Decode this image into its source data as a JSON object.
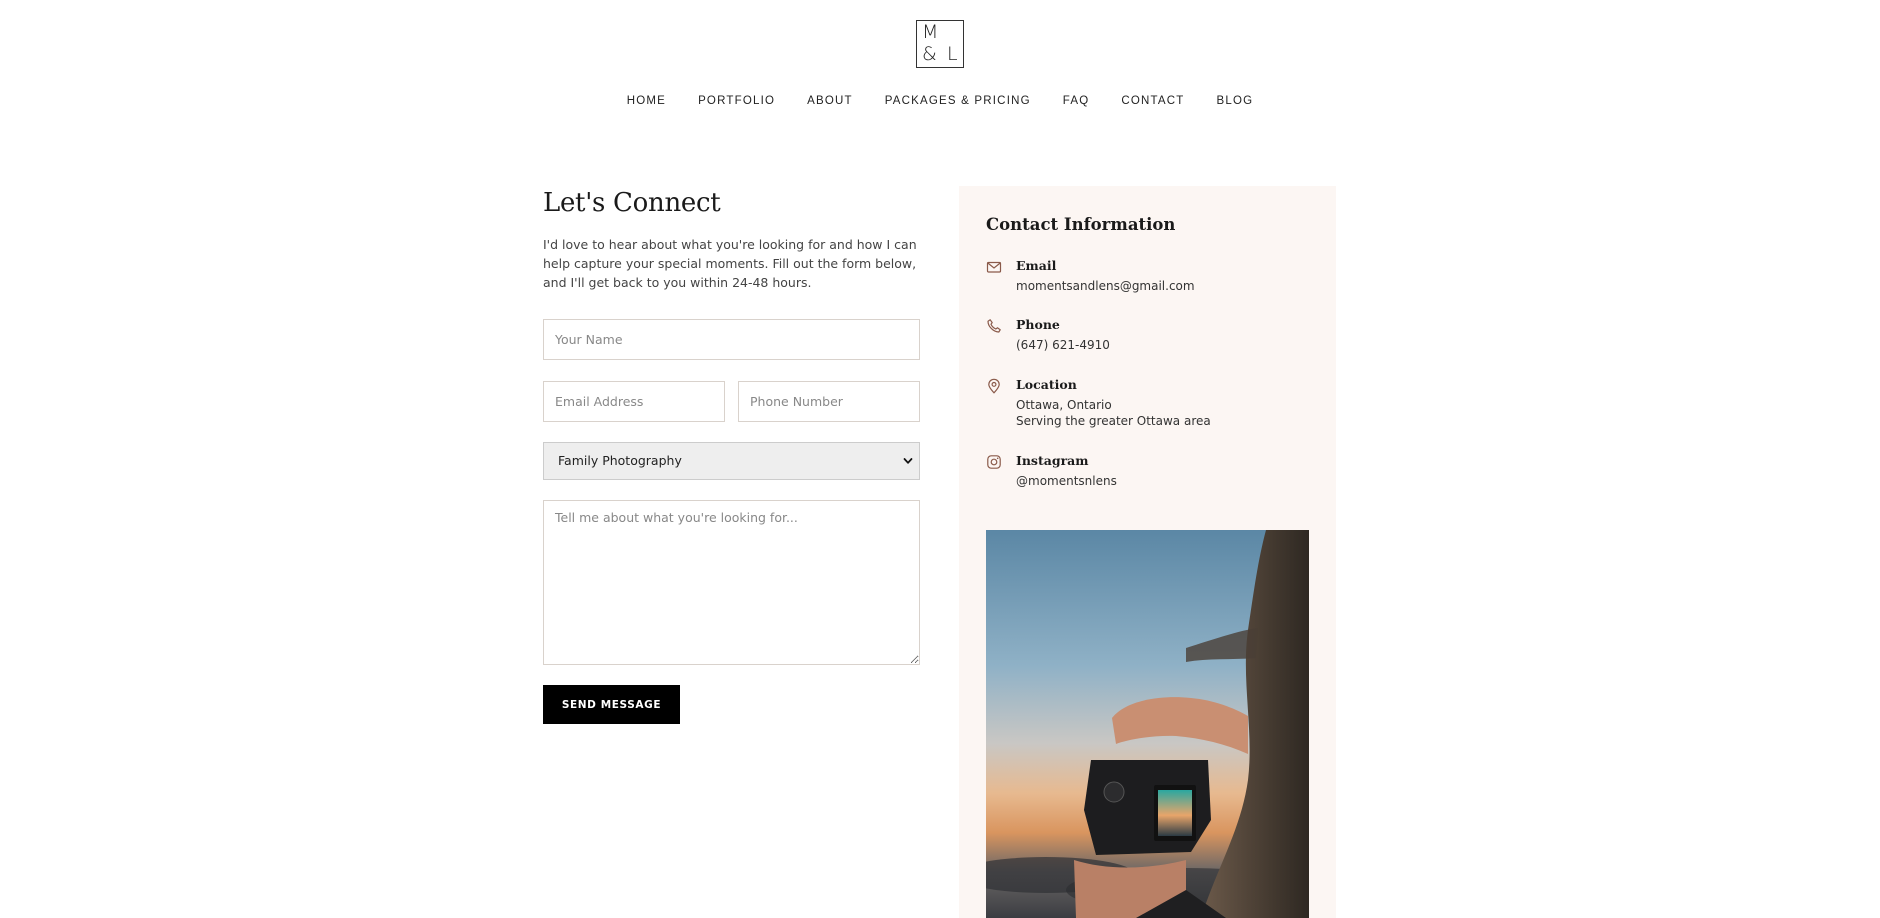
{
  "logo": {
    "line1": "M",
    "amp": "&",
    "line2": "L"
  },
  "nav": {
    "items": [
      "HOME",
      "PORTFOLIO",
      "ABOUT",
      "PACKAGES & PRICING",
      "FAQ",
      "CONTACT",
      "BLOG"
    ]
  },
  "form": {
    "title": "Let's Connect",
    "intro": "I'd love to hear about what you're looking for and how I can help capture your special moments. Fill out the form below, and I'll get back to you within 24-48 hours.",
    "name_placeholder": "Your Name",
    "email_placeholder": "Email Address",
    "phone_placeholder": "Phone Number",
    "service_selected": "Family Photography",
    "message_placeholder": "Tell me about what you're looking for...",
    "submit_label": "SEND MESSAGE"
  },
  "contact": {
    "title": "Contact Information",
    "email": {
      "label": "Email",
      "value": "momentsandlens@gmail.com",
      "icon": "mail-icon"
    },
    "phone": {
      "label": "Phone",
      "value": "(647) 621-4910",
      "icon": "phone-icon"
    },
    "location": {
      "label": "Location",
      "line1": "Ottawa, Ontario",
      "line2": "Serving the greater Ottawa area",
      "icon": "map-pin-icon"
    },
    "instagram": {
      "label": "Instagram",
      "value": "@momentsnlens",
      "icon": "instagram-icon"
    }
  },
  "colors": {
    "panel_bg": "#fcf6f3",
    "icon": "#8a5a4a",
    "button_bg": "#000000",
    "select_bg": "#eeeeee"
  }
}
